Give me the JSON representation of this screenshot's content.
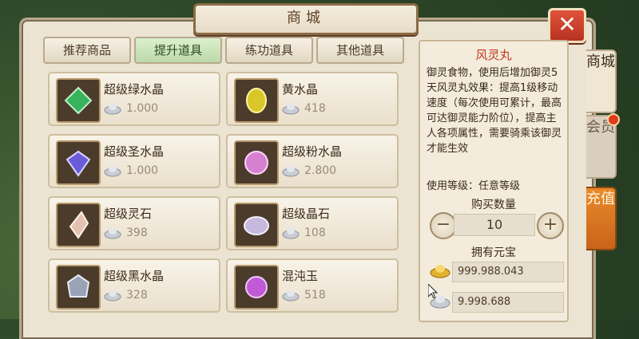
{
  "header": {
    "title": "商城",
    "close_label": "✕"
  },
  "tabs": [
    {
      "label": "推荐商品",
      "active": false
    },
    {
      "label": "提升道具",
      "active": true
    },
    {
      "label": "练功道具",
      "active": false
    },
    {
      "label": "其他道具",
      "active": false
    }
  ],
  "items": [
    {
      "name": "超级绿水晶",
      "price": "1.000",
      "icon": "green-crystal-icon",
      "color": "#37b35c"
    },
    {
      "name": "黄水晶",
      "price": "418",
      "icon": "yellow-crystal-icon",
      "color": "#d9c72a"
    },
    {
      "name": "超级圣水晶",
      "price": "1.000",
      "icon": "holy-crystal-icon",
      "color": "#6a5cd9"
    },
    {
      "name": "超级粉水晶",
      "price": "2.800",
      "icon": "pink-crystal-icon",
      "color": "#d77fd0"
    },
    {
      "name": "超级灵石",
      "price": "398",
      "icon": "spirit-stone-icon",
      "color": "#e3c3b0"
    },
    {
      "name": "超级晶石",
      "price": "108",
      "icon": "crystal-stone-icon",
      "color": "#c7b8dd"
    },
    {
      "name": "超级黑水晶",
      "price": "328",
      "icon": "black-crystal-icon",
      "color": "#9aa3b6"
    },
    {
      "name": "混沌玉",
      "price": "518",
      "icon": "chaos-jade-icon",
      "color": "#c05ad6"
    }
  ],
  "detail": {
    "title": "风灵丸",
    "description": "御灵食物，使用后增加御灵5天风灵丸效果：提高1级移动速度（每次使用可累计，最高可达御灵能力阶位），提高主人各项属性，需要骑乘该御灵才能生效",
    "level": "使用等级：任意等级",
    "qty_label": "购买数量",
    "qty_value": "10",
    "minus": "−",
    "plus": "+",
    "wealth_label": "拥有元宝",
    "gold_value": "999.988.043",
    "silver_value": "9.998.688"
  },
  "side_tabs": {
    "shop": "商城",
    "member": "会员",
    "recharge": "充值"
  },
  "colors": {
    "accent_red": "#c13a22",
    "active_tab": "#bcd9a8",
    "recharge": "#e98a2a"
  }
}
